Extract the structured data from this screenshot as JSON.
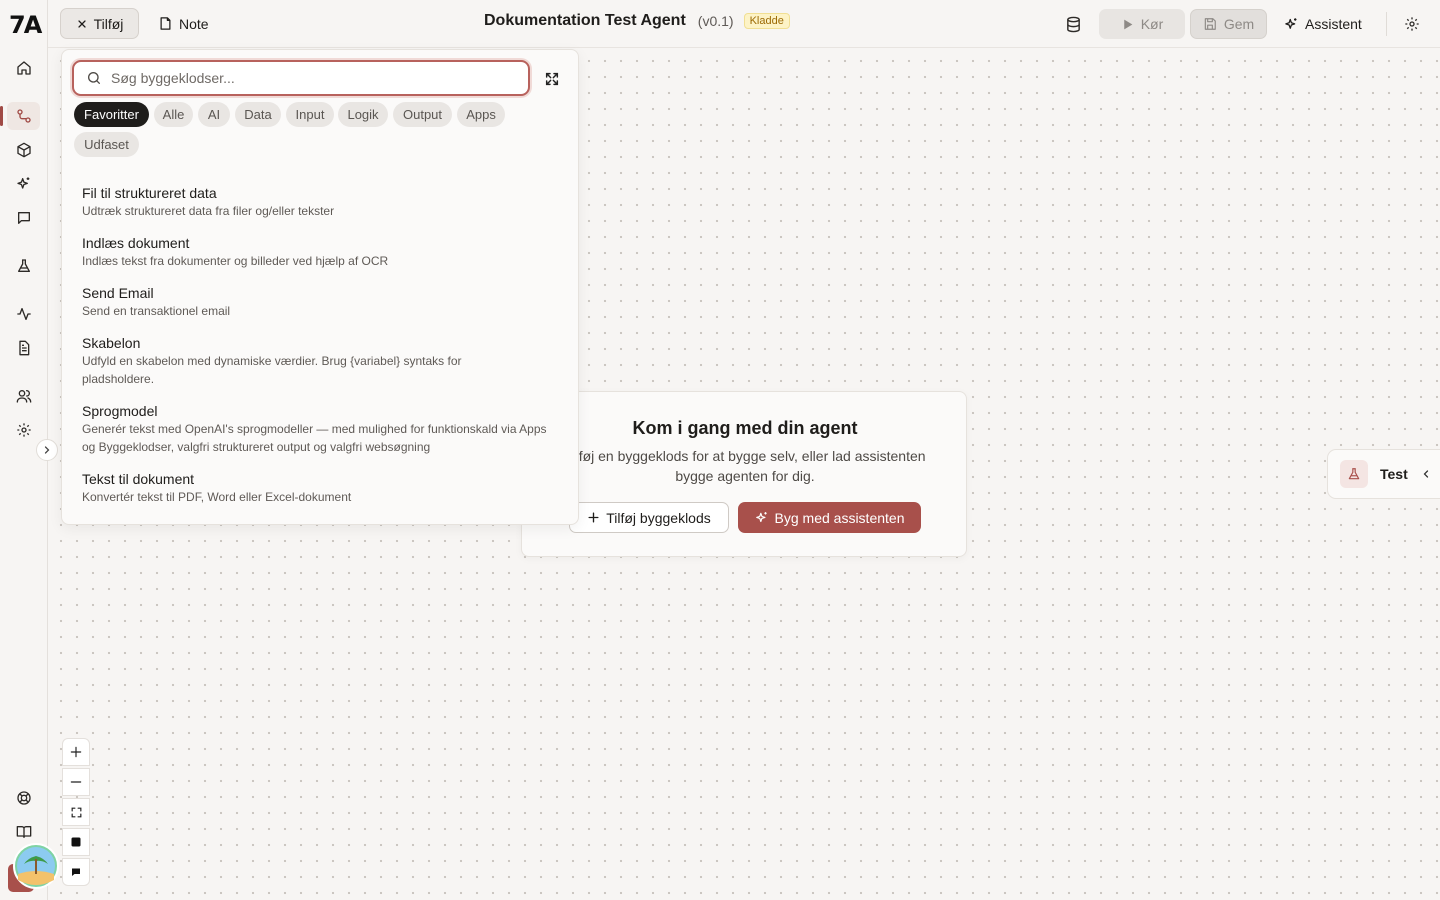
{
  "app": {
    "logo_text": "7A"
  },
  "header": {
    "add_label": "Tilføj",
    "note_label": "Note",
    "title": "Dokumentation Test Agent",
    "version": "(v0.1)",
    "status_badge": "Kladde",
    "run_label": "Kør",
    "save_label": "Gem",
    "assistant_label": "Assistent"
  },
  "search": {
    "placeholder": "Søg byggeklodser...",
    "value": ""
  },
  "filters": [
    "Favoritter",
    "Alle",
    "AI",
    "Data",
    "Input",
    "Logik",
    "Output",
    "Apps",
    "Udfaset"
  ],
  "active_filter": "Favoritter",
  "blocks": [
    {
      "title": "Fil til struktureret data",
      "description": "Udtræk struktureret data fra filer og/eller tekster"
    },
    {
      "title": "Indlæs dokument",
      "description": "Indlæs tekst fra dokumenter og billeder ved hjælp af OCR"
    },
    {
      "title": "Send Email",
      "description": "Send en transaktionel email"
    },
    {
      "title": "Skabelon",
      "description": "Udfyld en skabelon med dynamiske værdier. Brug {variabel} syntaks for pladsholdere."
    },
    {
      "title": "Sprogmodel",
      "description": "Generér tekst med OpenAI's sprogmodeller — med mulighed for funktionskald via Apps og Byggeklodser, valgfri struktureret output og valgfri websøgning"
    },
    {
      "title": "Tekst til dokument",
      "description": "Konvertér tekst til PDF, Word eller Excel-dokument"
    }
  ],
  "start_card": {
    "title": "Kom i gang med din agent",
    "description": "Tilføj en byggeklods for at bygge selv, eller lad assistenten bygge agenten for dig.",
    "add_block_label": "Tilføj byggeklods",
    "build_label": "Byg med assistenten"
  },
  "test_panel": {
    "label": "Test"
  },
  "colors": {
    "accent": "#a8504b",
    "background": "#f7f5f3",
    "badge_bg": "#fdf3c6"
  }
}
